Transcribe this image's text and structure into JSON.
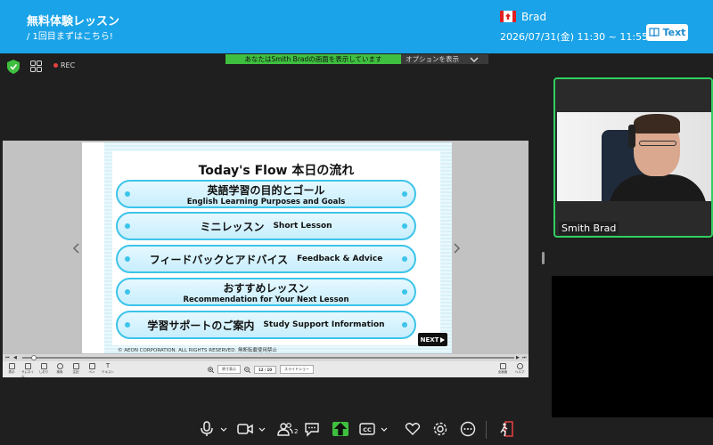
{
  "header": {
    "title": "無料体験レッスン",
    "subtitle": "/ 1回目まずはこちら!",
    "user_name": "Brad",
    "datetime": "2026/07/31(金) 11:30 ~ 11:55",
    "text_button": "Text"
  },
  "toolbar": {
    "rec_label": "REC",
    "share_banner": "あなたはSmith Bradの画面を表示しています",
    "share_options": "オプションを表示"
  },
  "slide": {
    "title": "Today's Flow 本日の流れ",
    "items": [
      {
        "jp": "英語学習の目的とゴール",
        "en": "English Learning Purposes and Goals"
      },
      {
        "jp": "ミニレッスン",
        "en": "Short Lesson"
      },
      {
        "jp": "フィードバックとアドバイス",
        "en": "Feedback & Advice"
      },
      {
        "jp": "おすすめレッスン",
        "en": "Recommendation for Your Next Lesson"
      },
      {
        "jp": "学習サポートのご案内",
        "en": "Study Support Information"
      }
    ],
    "copyright": "© AEON CORPORATION. ALL RIGHTS RESERVED. 無断転載使用禁止",
    "next_label": "NEXT"
  },
  "viewer": {
    "page_box": "12",
    "page_total": "10",
    "zoom_label": "原寸表示",
    "slideshow_label": "スライドショー",
    "controls": [
      "表示",
      "サムネイル",
      "しおり",
      "検索",
      "注記",
      "ペン",
      "テキスト"
    ],
    "right_controls": [
      "全画面",
      "ヘルプ"
    ]
  },
  "participant": {
    "name": "Smith Brad"
  },
  "bottom_bar": {
    "participants_count": "2"
  },
  "colors": {
    "header_blue": "#1aa3e8",
    "active_green": "#30d060",
    "share_green": "#3fbf3f",
    "pill_blue": "#3cc4ea"
  },
  "icons": [
    "shield-check-icon",
    "grid-icon",
    "book-icon",
    "chevron-down-icon",
    "chevron-left-icon",
    "chevron-right-icon",
    "microphone-icon",
    "video-camera-icon",
    "participants-icon",
    "chat-icon",
    "share-screen-icon",
    "closed-caption-icon",
    "heart-icon",
    "gear-icon",
    "more-icon",
    "leave-icon"
  ]
}
